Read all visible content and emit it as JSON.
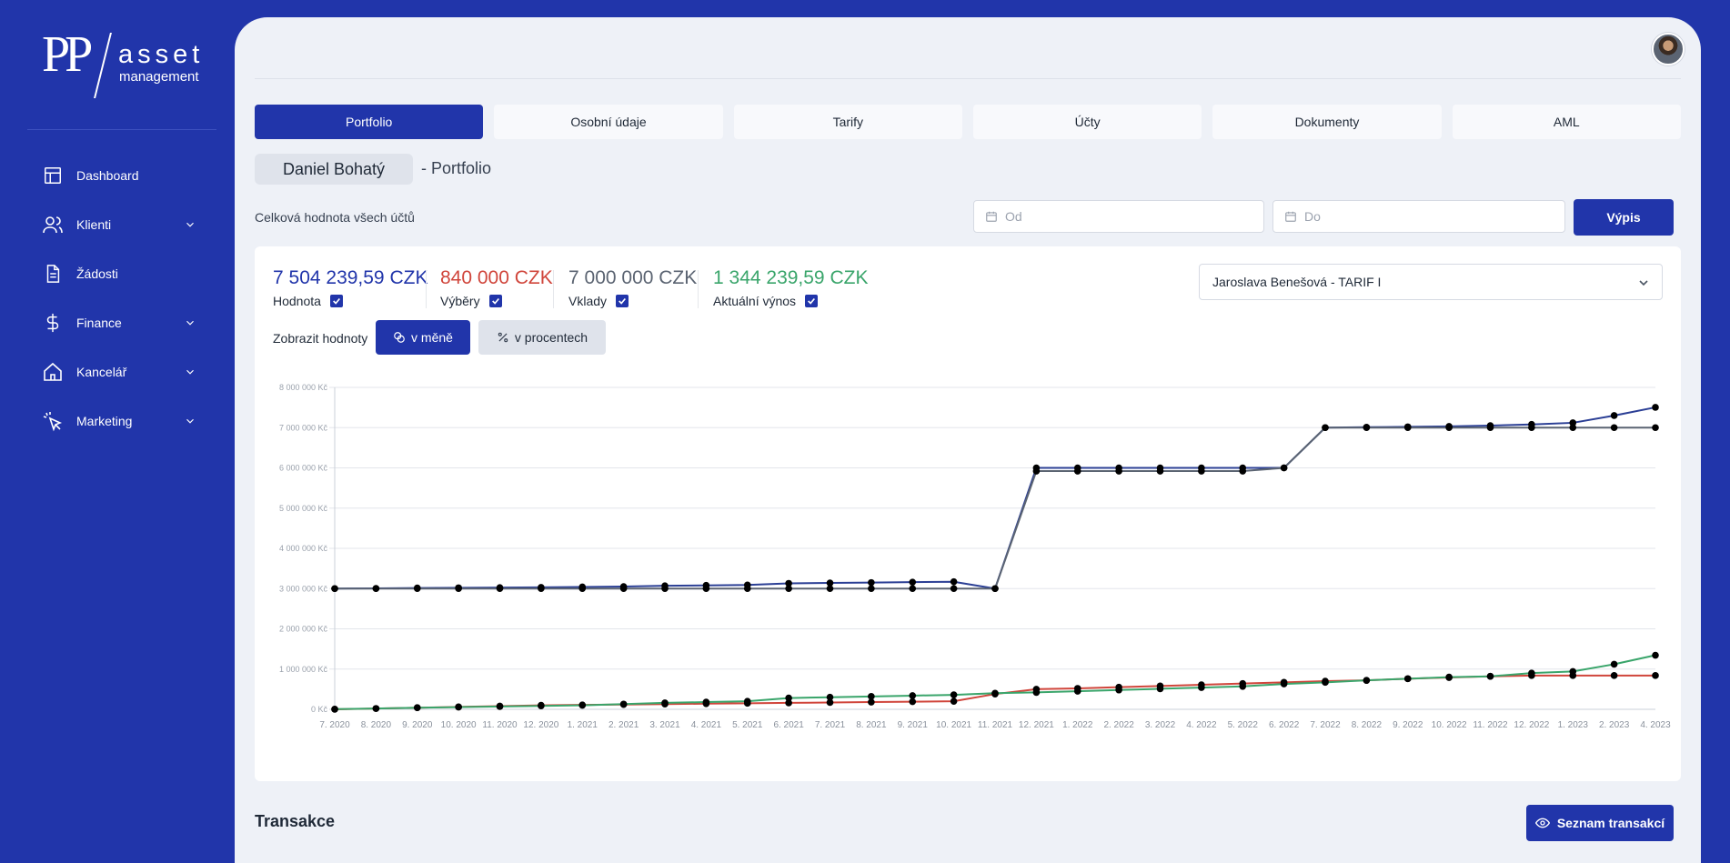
{
  "brand": {
    "mark": "PP",
    "word": "asset",
    "sub": "management"
  },
  "sidebar": {
    "items": [
      {
        "label": "Dashboard",
        "icon": "layout-icon",
        "expandable": false
      },
      {
        "label": "Klienti",
        "icon": "users-icon",
        "expandable": true
      },
      {
        "label": "Žádosti",
        "icon": "document-icon",
        "expandable": false
      },
      {
        "label": "Finance",
        "icon": "dollar-icon",
        "expandable": true
      },
      {
        "label": "Kancelář",
        "icon": "home-icon",
        "expandable": true
      },
      {
        "label": "Marketing",
        "icon": "cursor-click-icon",
        "expandable": true
      }
    ]
  },
  "tabs": [
    {
      "label": "Portfolio",
      "active": true
    },
    {
      "label": "Osobní údaje",
      "active": false
    },
    {
      "label": "Tarify",
      "active": false
    },
    {
      "label": "Účty",
      "active": false
    },
    {
      "label": "Dokumenty",
      "active": false
    },
    {
      "label": "AML",
      "active": false
    }
  ],
  "client": {
    "name": "Daniel Bohatý",
    "suffix": "- Portfolio"
  },
  "filters": {
    "total_label": "Celková hodnota všech účtů",
    "from_placeholder": "Od",
    "to_placeholder": "Do",
    "submit": "Výpis"
  },
  "stats": [
    {
      "value": "7 504 239,59 CZK",
      "label": "Hodnota",
      "color": "#2135aa",
      "checked": true
    },
    {
      "value": "840 000 CZK",
      "label": "Výběry",
      "color": "#d0453b",
      "checked": true
    },
    {
      "value": "7 000 000 CZK",
      "label": "Vklady",
      "color": "#5b6472",
      "checked": true
    },
    {
      "value": "1 344 239,59 CZK",
      "label": "Aktuální výnos",
      "color": "#3aa56b",
      "checked": true
    }
  ],
  "tariff_select": {
    "value": "Jaroslava Benešová - TARIF I"
  },
  "display_mode": {
    "label": "Zobrazit hodnoty",
    "options": [
      "v měně",
      "v procentech"
    ],
    "selected": "v měně"
  },
  "chart_data": {
    "type": "line",
    "x": [
      "7. 2020",
      "8. 2020",
      "9. 2020",
      "10. 2020",
      "11. 2020",
      "12. 2020",
      "1. 2021",
      "2. 2021",
      "3. 2021",
      "4. 2021",
      "5. 2021",
      "6. 2021",
      "7. 2021",
      "8. 2021",
      "9. 2021",
      "10. 2021",
      "11. 2021",
      "12. 2021",
      "1. 2022",
      "2. 2022",
      "3. 2022",
      "4. 2022",
      "5. 2022",
      "6. 2022",
      "7. 2022",
      "8. 2022",
      "9. 2022",
      "10. 2022",
      "11. 2022",
      "12. 2022",
      "1. 2023",
      "2. 2023",
      "4. 2023"
    ],
    "y_ticks": [
      "0 Kč",
      "1 000 000 Kč",
      "2 000 000 Kč",
      "3 000 000 Kč",
      "4 000 000 Kč",
      "5 000 000 Kč",
      "6 000 000 Kč",
      "7 000 000 Kč",
      "8 000 000 Kč"
    ],
    "ylim": [
      0,
      8000000
    ],
    "grid": true,
    "series": [
      {
        "color": "#2b3f95",
        "values": [
          3000000,
          3005000,
          3015000,
          3020000,
          3025000,
          3030000,
          3040000,
          3050000,
          3070000,
          3080000,
          3090000,
          3130000,
          3140000,
          3150000,
          3160000,
          3170000,
          3000000,
          6000000,
          6000000,
          6000000,
          6000000,
          6000000,
          6000000,
          6000000,
          7000000,
          7010000,
          7020000,
          7030000,
          7050000,
          7080000,
          7120000,
          7300000,
          7504240
        ]
      },
      {
        "color": "#5b6472",
        "values": [
          3000000,
          3000000,
          3000000,
          3000000,
          3000000,
          3000000,
          3000000,
          3000000,
          3000000,
          3000000,
          3000000,
          3000000,
          3000000,
          3000000,
          3000000,
          3000000,
          3000000,
          5920000,
          5920000,
          5920000,
          5920000,
          5920000,
          5920000,
          6000000,
          7000000,
          7000000,
          7000000,
          7000000,
          7000000,
          7000000,
          7000000,
          7000000,
          7000000
        ]
      },
      {
        "color": "#d0453b",
        "values": [
          0,
          20000,
          40000,
          60000,
          80000,
          100000,
          110000,
          120000,
          130000,
          140000,
          150000,
          160000,
          170000,
          180000,
          190000,
          200000,
          380000,
          500000,
          520000,
          550000,
          580000,
          610000,
          640000,
          670000,
          700000,
          720000,
          760000,
          790000,
          820000,
          840000,
          840000,
          840000,
          840000
        ]
      },
      {
        "color": "#3aa56b",
        "values": [
          5000,
          20000,
          40000,
          55000,
          70000,
          85000,
          100000,
          130000,
          160000,
          180000,
          200000,
          280000,
          300000,
          320000,
          340000,
          360000,
          400000,
          420000,
          450000,
          480000,
          510000,
          540000,
          570000,
          630000,
          670000,
          720000,
          760000,
          800000,
          820000,
          900000,
          940000,
          1120000,
          1344240
        ]
      }
    ]
  },
  "transactions": {
    "title": "Transakce",
    "button": "Seznam transakcí"
  }
}
